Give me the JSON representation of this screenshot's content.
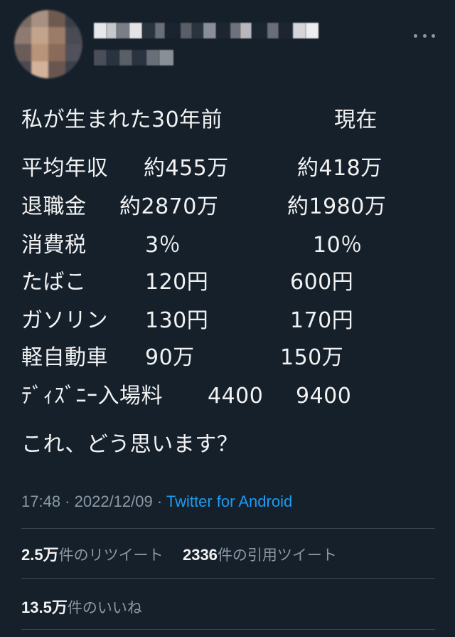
{
  "tweet": {
    "intro": "私が生まれた30年前",
    "now_header": "現在",
    "rows": [
      {
        "label": "平均年収",
        "then": "約455万",
        "now": "約418万"
      },
      {
        "label": "退職金",
        "then": "約2870万",
        "now": "約1980万"
      },
      {
        "label": "消費税",
        "then": "3％",
        "now": "10％"
      },
      {
        "label": "たばこ",
        "then": "120円",
        "now": "600円"
      },
      {
        "label": "ガソリン",
        "then": "130円",
        "now": "170円"
      },
      {
        "label": "軽自動車",
        "then": "90万",
        "now": "150万"
      },
      {
        "label": "ﾃﾞｨｽﾞﾆｰ入場料",
        "then": "4400",
        "now": "9400"
      }
    ],
    "question": "これ、どう思います？"
  },
  "meta": {
    "time": "17:48",
    "separator": " · ",
    "date": "2022/12/09",
    "source": "Twitter for Android"
  },
  "stats": {
    "retweets_count": "2.5万",
    "retweets_label": "件のリツイート",
    "quotes_count": "2336",
    "quotes_label": "件の引用ツイート",
    "likes_count": "13.5万",
    "likes_label": "件のいいね"
  },
  "icons": {
    "more": "more-horizontal-icon"
  },
  "colors": {
    "background": "#15202b",
    "text": "#f2f2f2",
    "muted": "#8b98a5",
    "link": "#1d9bf0",
    "divider": "#38444d"
  }
}
